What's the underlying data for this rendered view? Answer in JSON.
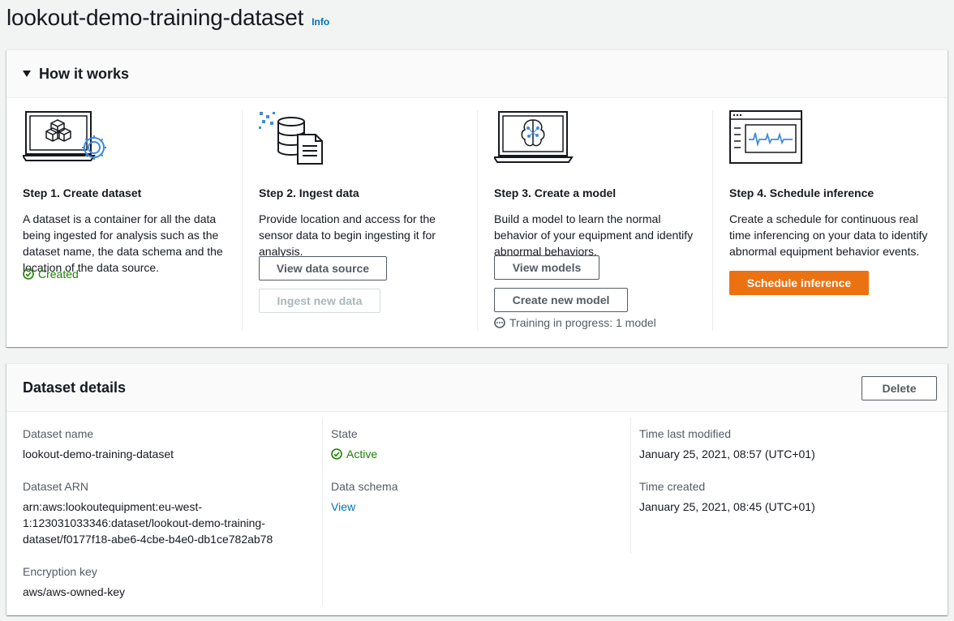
{
  "header": {
    "title": "lookout-demo-training-dataset",
    "info": "Info"
  },
  "how_it_works": {
    "title": "How it works",
    "steps": [
      {
        "title": "Step 1. Create dataset",
        "description": "A dataset is a container for all the data being ingested for analysis such as the dataset name, the data schema and the location of the data source.",
        "status": "Created",
        "icon": "dataset-laptop-icon"
      },
      {
        "title": "Step 2. Ingest data",
        "description": "Provide location and access for the sensor data to begin ingesting it for analysis.",
        "buttons": [
          "View data source",
          "Ingest new data"
        ],
        "icon": "ingest-data-icon"
      },
      {
        "title": "Step 3. Create a model",
        "description": "Build a model to learn the normal behavior of your equipment and identify abnormal behaviors.",
        "buttons": [
          "View models",
          "Create new model"
        ],
        "status": "Training in progress: 1 model",
        "icon": "model-laptop-icon"
      },
      {
        "title": "Step 4. Schedule inference",
        "description": "Create a schedule for continuous real time inferencing on your data to identify abnormal equipment behavior events.",
        "buttons": [
          "Schedule inference"
        ],
        "icon": "inference-dashboard-icon"
      }
    ]
  },
  "details": {
    "title": "Dataset details",
    "delete_label": "Delete",
    "dataset_name_label": "Dataset name",
    "dataset_name": "lookout-demo-training-dataset",
    "arn_label": "Dataset ARN",
    "arn_lines": [
      "arn:aws:lookoutequipment:eu-west-",
      "1:123031033346:dataset/lookout-demo-training-",
      "dataset/f0177f18-abe6-4cbe-b4e0-db1ce782ab78"
    ],
    "encryption_label": "Encryption key",
    "encryption_key": "aws/aws-owned-key",
    "state_label": "State",
    "state": "Active",
    "schema_label": "Data schema",
    "schema_link": "View",
    "modified_label": "Time last modified",
    "modified": "January 25, 2021, 08:57 (UTC+01)",
    "created_label": "Time created",
    "created": "January 25, 2021, 08:45 (UTC+01)"
  },
  "colors": {
    "accent": "#ec7211",
    "link": "#0073bb",
    "success": "#1d8102",
    "icon_blue": "#3f8ae0"
  }
}
